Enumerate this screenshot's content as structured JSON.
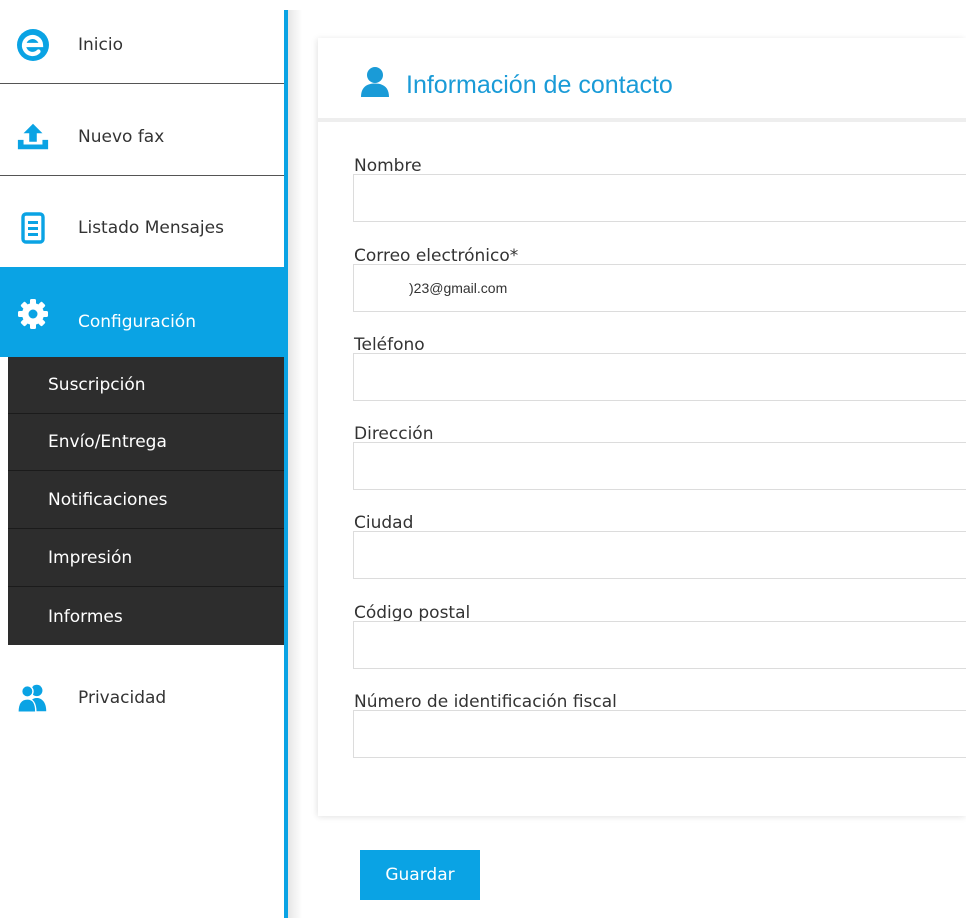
{
  "sidebar": {
    "items": [
      {
        "label": "Inicio",
        "icon": "e-logo-icon"
      },
      {
        "label": "Nuevo fax",
        "icon": "upload-icon"
      },
      {
        "label": "Listado Mensajes",
        "icon": "document-icon"
      },
      {
        "label": "Configuración",
        "icon": "gear-icon"
      },
      {
        "label": "Privacidad",
        "icon": "users-icon"
      }
    ],
    "submenu": [
      {
        "label": "Suscripción"
      },
      {
        "label": "Envío/Entrega"
      },
      {
        "label": "Notificaciones"
      },
      {
        "label": "Impresión"
      },
      {
        "label": "Informes"
      }
    ]
  },
  "form": {
    "title": "Información de contacto",
    "fields": [
      {
        "label": "Nombre",
        "value": ""
      },
      {
        "label": "Correo electrónico*",
        "value": ")23@gmail.com"
      },
      {
        "label": "Teléfono",
        "value": ""
      },
      {
        "label": "Dirección",
        "value": ""
      },
      {
        "label": "Ciudad",
        "value": ""
      },
      {
        "label": "Código postal",
        "value": ""
      },
      {
        "label": "Número de identificación fiscal",
        "value": ""
      }
    ],
    "save_label": "Guardar"
  },
  "colors": {
    "accent": "#0aa3e4",
    "title": "#1a9bd7",
    "submenu_bg": "#2d2d2d"
  }
}
